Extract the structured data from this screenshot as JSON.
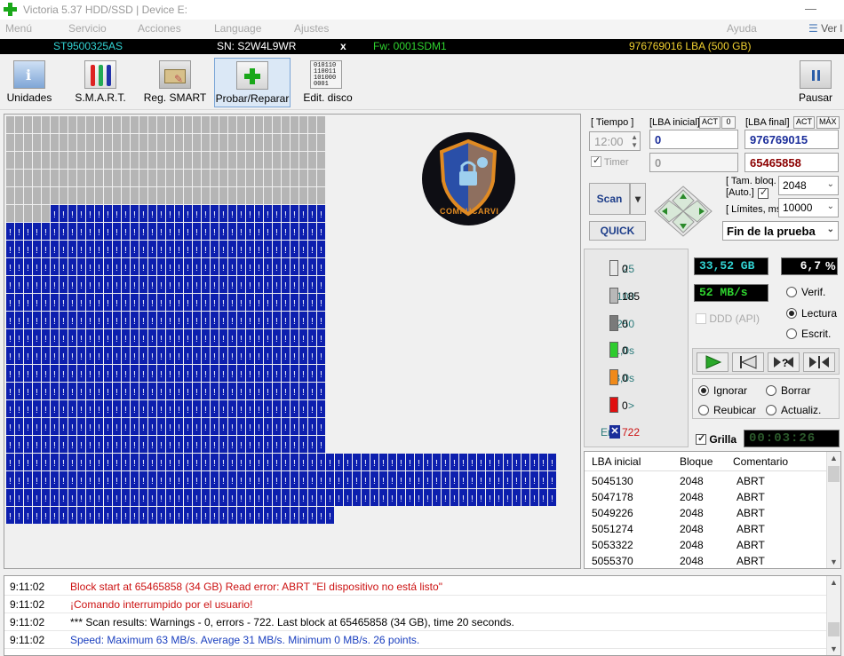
{
  "window": {
    "title": "Victoria 5.37 HDD/SSD | Device E:"
  },
  "menu": {
    "items": [
      "Menú",
      "Servicio",
      "Acciones",
      "Language",
      "Ajustes"
    ],
    "help": "Ayuda",
    "view": "Ver l"
  },
  "device": {
    "model": "ST9500325AS",
    "serial": "SN: S2W4L9WR",
    "close": "x",
    "firmware": "Fw: 0001SDM1",
    "capacity": "976769016 LBA (500 GB)"
  },
  "toolbar": {
    "buttons": [
      "Unidades",
      "S.M.A.R.T.",
      "Reg. SMART",
      "Probar/Reparar",
      "Edit. disco"
    ],
    "pause": "Pausar",
    "edit_icon_text": "010110 110011 101000 0001"
  },
  "map": {
    "grid_blocks": 185,
    "error_blocks": 722,
    "logo_text": "COMPUCARVI"
  },
  "controls": {
    "time_label": "[ Tiempo ]",
    "time_value": "12:00",
    "timer_label": "Timer",
    "lba_start_label": "[LBA inicial]",
    "lba_start_act": "ACT",
    "lba_start_zero": "0",
    "lba_start_value": "0",
    "lba_start_value2": "0",
    "lba_end_label": "[LBA final]",
    "lba_end_act": "ACT",
    "lba_end_max": "MÁX",
    "lba_end_value": "976769015",
    "lba_end_value2": "65465858",
    "block_size_label": "[ Tam. bloq. ]",
    "auto_label": "[Auto.]",
    "block_size_value": "2048",
    "limits_label": "[ Límites, ms ]",
    "limits_value": "10000",
    "scan_label": "Scan",
    "quick_label": "QUICK",
    "end_action": "Fin de la prueba"
  },
  "legend": [
    {
      "label": "25",
      "count": "0",
      "color": "#e8e8e8"
    },
    {
      "label": "100",
      "count": "185",
      "color": "#b8b8b8"
    },
    {
      "label": "250",
      "count": "0",
      "color": "#7a7a7a"
    },
    {
      "label": "1,0s",
      "count": "0",
      "color": "#2ecc2e"
    },
    {
      "label": "3,0s",
      "count": "0",
      "color": "#f08a1a"
    },
    {
      "label": ">",
      "count": "0",
      "color": "#e01010"
    }
  ],
  "errors": {
    "label": "Err",
    "count": "722"
  },
  "stats": {
    "size": "33,52 GB",
    "percent": "6,7",
    "percent_sign": "%",
    "speed": "52 MB/s",
    "ddd_label": "DDD (API)",
    "grid_label": "Grilla",
    "grid_timer": "00:03:26"
  },
  "modes": [
    "Verif.",
    "Lectura",
    "Escrit."
  ],
  "actions": [
    "Ignorar",
    "Borrar",
    "Reubicar",
    "Actualiz."
  ],
  "table": {
    "headers": [
      "LBA inicial",
      "Bloque",
      "Comentario"
    ],
    "rows": [
      [
        "5045130",
        "2048",
        "ABRT"
      ],
      [
        "5047178",
        "2048",
        "ABRT"
      ],
      [
        "5049226",
        "2048",
        "ABRT"
      ],
      [
        "5051274",
        "2048",
        "ABRT"
      ],
      [
        "5053322",
        "2048",
        "ABRT"
      ],
      [
        "5055370",
        "2048",
        "ABRT"
      ]
    ]
  },
  "log": [
    {
      "time": "9:11:02",
      "text": "Block start at 65465858 (34 GB) Read error: ABRT \"El dispositivo no está listo\"",
      "color": "#cc1111"
    },
    {
      "time": "9:11:02",
      "text": "¡Comando interrumpido por el usuario!",
      "color": "#cc1111"
    },
    {
      "time": "9:11:02",
      "text": "*** Scan results: Warnings - 0, errors - 722. Last block at 65465858 (34 GB), time 20 seconds.",
      "color": "#000000"
    },
    {
      "time": "9:11:02",
      "text": "Speed: Maximum 63 MB/s. Average 31 MB/s. Minimum 0 MB/s. 26 points.",
      "color": "#1a3fbf"
    }
  ],
  "colors": {
    "error_block": "#0d1fae",
    "ok_block": "#b5b5b5",
    "lba_end_red": "#8b0000"
  }
}
